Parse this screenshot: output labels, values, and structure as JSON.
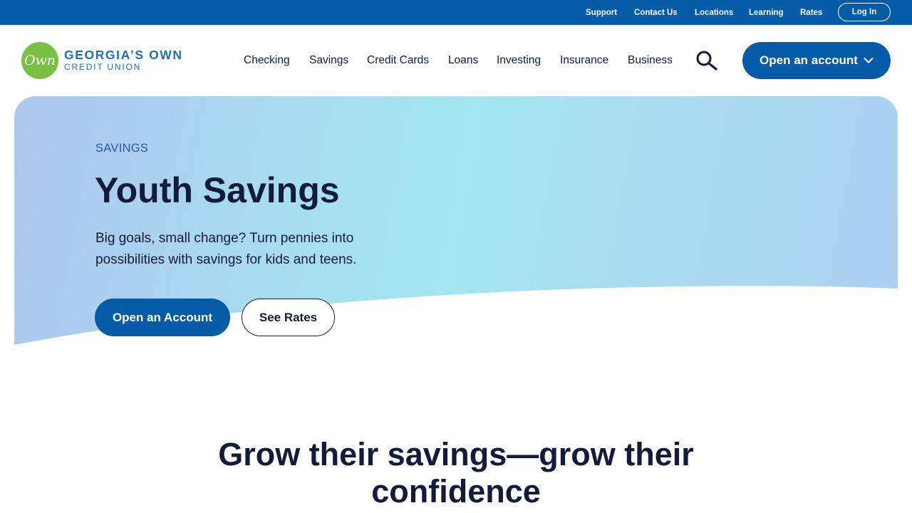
{
  "utility_nav": {
    "links": [
      "Support",
      "Contact Us",
      "Locations",
      "Learning",
      "Rates"
    ],
    "login_label": "Log In"
  },
  "brand": {
    "logo_mark": "Own",
    "name_line1": "GEORGIA’S OWN",
    "name_line2": "CREDIT UNION",
    "colors": {
      "primary": "#045ca8",
      "logo_green": "#79c143",
      "text_dark": "#131b3b",
      "eyebrow": "#2a52be"
    }
  },
  "main_nav": {
    "items": [
      "Checking",
      "Savings",
      "Credit Cards",
      "Loans",
      "Investing",
      "Insurance",
      "Business"
    ],
    "search_icon": "search-icon",
    "cta_label": "Open an account",
    "cta_icon": "chevron-down-icon"
  },
  "hero": {
    "eyebrow": "SAVINGS",
    "title": "Youth Savings",
    "description": "Big goals, small change? Turn pennies into possibilities with savings for kids and teens.",
    "primary_button": "Open an Account",
    "secondary_button": "See Rates"
  },
  "section": {
    "heading": "Grow their savings—grow their confidence"
  }
}
